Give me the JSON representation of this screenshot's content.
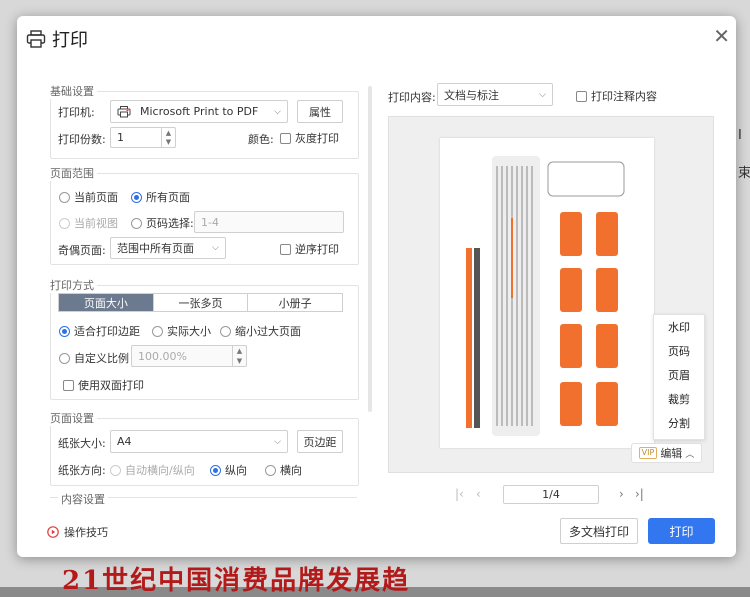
{
  "background": {
    "headline": "21世纪中国消费品牌发展趋"
  },
  "dialog": {
    "title": "打印"
  },
  "basic": {
    "legend": "基础设置",
    "printer_label": "打印机:",
    "printer_value": "Microsoft Print to PDF",
    "properties_button": "属性",
    "copies_label": "打印份数:",
    "copies_value": "1",
    "color_label": "颜色:",
    "grayscale_label": "灰度打印"
  },
  "range": {
    "legend": "页面范围",
    "current_page": "当前页面",
    "all_pages": "所有页面",
    "current_view": "当前视图",
    "page_select": "页码选择:",
    "page_select_placeholder": "1-4",
    "odd_even_label": "奇偶页面:",
    "odd_even_value": "范围中所有页面",
    "reverse_label": "逆序打印"
  },
  "mode": {
    "legend": "打印方式",
    "tabs": [
      "页面大小",
      "一张多页",
      "小册子"
    ],
    "fit_margin": "适合打印边距",
    "actual_size": "实际大小",
    "shrink_large": "缩小过大页面",
    "custom_scale": "自定义比例",
    "scale_value": "100.00%",
    "duplex": "使用双面打印"
  },
  "page_setup": {
    "legend": "页面设置",
    "paper_size_label": "纸张大小:",
    "paper_size_value": "A4",
    "margin_button": "页边距",
    "orientation_label": "纸张方向:",
    "auto": "自动横向/纵向",
    "portrait": "纵向",
    "landscape": "横向"
  },
  "content_setup": {
    "legend": "内容设置"
  },
  "tips": "操作技巧",
  "print_content": {
    "label": "打印内容:",
    "value": "文档与标注",
    "annotations_label": "打印注释内容"
  },
  "preview_menu": {
    "items": [
      "水印",
      "页码",
      "页眉",
      "裁剪",
      "分割"
    ],
    "edit_badge": "VIP",
    "edit_label": "编辑"
  },
  "pagination": {
    "current": "1/4"
  },
  "footer": {
    "multi_doc": "多文档打印",
    "print": "打印"
  },
  "colors": {
    "accent": "#3377f0",
    "tab_active": "#6b7a8f",
    "orange": "#f2702e"
  }
}
